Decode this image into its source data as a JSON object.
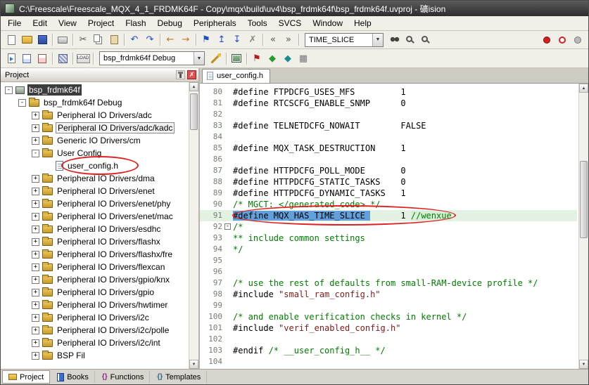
{
  "window": {
    "title": "C:\\Freescale\\Freescale_MQX_4_1_FRDMK64F - Copy\\mqx\\build\\uv4\\bsp_frdmk64f\\bsp_frdmk64f.uvproj - 礦ision"
  },
  "menubar": {
    "items": [
      "File",
      "Edit",
      "View",
      "Project",
      "Flash",
      "Debug",
      "Peripherals",
      "Tools",
      "SVCS",
      "Window",
      "Help"
    ]
  },
  "toolbar1": {
    "find_value": "TIME_SLICE",
    "before": [
      {
        "type": "icon",
        "name": "new-file-icon",
        "shape": "page"
      },
      {
        "type": "icon",
        "name": "open-file-icon",
        "shape": "folder-open"
      },
      {
        "type": "icon",
        "name": "save-icon",
        "shape": "floppy"
      },
      {
        "type": "sep"
      },
      {
        "type": "icon",
        "name": "print-icon",
        "shape": "printer"
      },
      {
        "type": "sep"
      },
      {
        "type": "icon",
        "name": "cut-icon",
        "glyph": "✂",
        "color": "#555555"
      },
      {
        "type": "icon",
        "name": "copy-icon",
        "shape": "copy"
      },
      {
        "type": "icon",
        "name": "paste-icon",
        "shape": "paste"
      },
      {
        "type": "sep"
      },
      {
        "type": "icon",
        "name": "undo-icon",
        "glyph": "↶",
        "color": "#2050c0"
      },
      {
        "type": "icon",
        "name": "redo-icon",
        "glyph": "↷",
        "color": "#2050c0"
      },
      {
        "type": "sep"
      },
      {
        "type": "icon",
        "name": "nav-back-icon",
        "glyph": "←",
        "color": "#c07820"
      },
      {
        "type": "icon",
        "name": "nav-forward-icon",
        "glyph": "→",
        "color": "#c07820"
      },
      {
        "type": "sep"
      },
      {
        "type": "icon",
        "name": "bookmark-toggle-icon",
        "glyph": "⚑",
        "color": "#2050c0"
      },
      {
        "type": "icon",
        "name": "bookmark-prev-icon",
        "glyph": "↥",
        "color": "#2050c0"
      },
      {
        "type": "icon",
        "name": "bookmark-next-icon",
        "glyph": "↧",
        "color": "#2050c0"
      },
      {
        "type": "icon",
        "name": "bookmark-clear-icon",
        "glyph": "✗",
        "color": "#888888"
      },
      {
        "type": "sep"
      },
      {
        "type": "icon",
        "name": "outdent-icon",
        "glyph": "«",
        "color": "#555555"
      },
      {
        "type": "icon",
        "name": "indent-icon",
        "glyph": "»",
        "color": "#555555"
      },
      {
        "type": "sep"
      }
    ],
    "after": [
      {
        "type": "icon",
        "name": "find-in-files-icon",
        "shape": "binoc"
      },
      {
        "type": "icon",
        "name": "find-icon",
        "shape": "mag"
      },
      {
        "type": "icon",
        "name": "incremental-find-icon",
        "shape": "mag"
      },
      {
        "type": "spacer"
      },
      {
        "type": "icon",
        "name": "insert-breakpoint-icon",
        "shape": "bp-red"
      },
      {
        "type": "icon",
        "name": "disable-breakpoint-icon",
        "shape": "bp-hollow"
      },
      {
        "type": "icon",
        "name": "kill-breakpoints-icon",
        "shape": "bp-gray"
      }
    ]
  },
  "toolbar2": {
    "target_value": "bsp_frdmk64f Debug",
    "before": [
      {
        "type": "icon",
        "name": "translate-icon",
        "shape": "page-arrow"
      },
      {
        "type": "icon",
        "name": "build-icon",
        "shape": "build"
      },
      {
        "type": "icon",
        "name": "rebuild-icon",
        "shape": "rebuild"
      },
      {
        "type": "sep"
      },
      {
        "type": "icon",
        "name": "batch-build-icon",
        "shape": "batch"
      },
      {
        "type": "sep"
      },
      {
        "type": "icon",
        "name": "flash-download-icon",
        "shape": "load",
        "text": "LOAD"
      },
      {
        "type": "sep"
      }
    ],
    "after": [
      {
        "type": "icon",
        "name": "options-for-target-icon",
        "shape": "wand"
      },
      {
        "type": "sep"
      },
      {
        "type": "icon",
        "name": "manage-items-icon",
        "shape": "items"
      },
      {
        "type": "sep"
      },
      {
        "type": "icon",
        "name": "flag-icon",
        "glyph": "⚑",
        "color": "#b02020"
      },
      {
        "type": "icon",
        "name": "next-diamond-icon",
        "glyph": "◆",
        "color": "#2a9a2a"
      },
      {
        "type": "icon",
        "name": "prev-diamond-icon",
        "glyph": "◆",
        "color": "#1a8a8a"
      },
      {
        "type": "icon",
        "name": "grid-icon",
        "glyph": "▦",
        "color": "#777777"
      }
    ]
  },
  "project_panel": {
    "title": "Project",
    "tree": [
      {
        "label": "bsp_frdmk64f",
        "indent": 0,
        "icon": "target",
        "expand": "-",
        "state": "selected"
      },
      {
        "label": "bsp_frdmk64f Debug",
        "indent": 1,
        "icon": "folder",
        "expand": "-"
      },
      {
        "label": "Peripheral IO Drivers/adc",
        "indent": 2,
        "icon": "folder",
        "expand": "+"
      },
      {
        "label": "Peripheral IO Drivers/adc/kadc",
        "indent": 2,
        "icon": "folder",
        "expand": "+",
        "state": "focused"
      },
      {
        "label": "Generic IO Drivers/cm",
        "indent": 2,
        "icon": "folder",
        "expand": "+"
      },
      {
        "label": "User Config",
        "indent": 2,
        "icon": "folder",
        "expand": "-"
      },
      {
        "label": "user_config.h",
        "indent": 3,
        "icon": "file",
        "expand": ""
      },
      {
        "label": "Peripheral IO Drivers/dma",
        "indent": 2,
        "icon": "folder",
        "expand": "+"
      },
      {
        "label": "Peripheral IO Drivers/enet",
        "indent": 2,
        "icon": "folder",
        "expand": "+"
      },
      {
        "label": "Peripheral IO Drivers/enet/phy",
        "indent": 2,
        "icon": "folder",
        "expand": "+"
      },
      {
        "label": "Peripheral IO Drivers/enet/mac",
        "indent": 2,
        "icon": "folder",
        "expand": "+"
      },
      {
        "label": "Peripheral IO Drivers/esdhc",
        "indent": 2,
        "icon": "folder",
        "expand": "+"
      },
      {
        "label": "Peripheral IO Drivers/flashx",
        "indent": 2,
        "icon": "folder",
        "expand": "+"
      },
      {
        "label": "Peripheral IO Drivers/flashx/fre",
        "indent": 2,
        "icon": "folder",
        "expand": "+"
      },
      {
        "label": "Peripheral IO Drivers/flexcan",
        "indent": 2,
        "icon": "folder",
        "expand": "+"
      },
      {
        "label": "Peripheral IO Drivers/gpio/knx",
        "indent": 2,
        "icon": "folder",
        "expand": "+"
      },
      {
        "label": "Peripheral IO Drivers/gpio",
        "indent": 2,
        "icon": "folder",
        "expand": "+"
      },
      {
        "label": "Peripheral IO Drivers/hwtimer",
        "indent": 2,
        "icon": "folder",
        "expand": "+"
      },
      {
        "label": "Peripheral IO Drivers/i2c",
        "indent": 2,
        "icon": "folder",
        "expand": "+"
      },
      {
        "label": "Peripheral IO Drivers/i2c/polle",
        "indent": 2,
        "icon": "folder",
        "expand": "+"
      },
      {
        "label": "Peripheral IO Drivers/i2c/int",
        "indent": 2,
        "icon": "folder",
        "expand": "+"
      },
      {
        "label": "BSP Fil",
        "indent": 2,
        "icon": "folder",
        "expand": "+"
      }
    ],
    "tabs": [
      {
        "label": "Project",
        "icon": "folder",
        "active": true
      },
      {
        "label": "Books",
        "icon": "book",
        "active": false
      },
      {
        "label": "Functions",
        "icon": "braces",
        "glyph": "{}",
        "active": false
      },
      {
        "label": "Templates",
        "icon": "braces2",
        "glyph": "{}",
        "active": false
      }
    ]
  },
  "editor": {
    "tab_label": "user_config.h",
    "lines": [
      {
        "n": 80,
        "seg": [
          [
            "ct",
            "#define FTPDCFG_USES_MFS         1"
          ]
        ]
      },
      {
        "n": 81,
        "seg": [
          [
            "ct",
            "#define RTCSCFG_ENABLE_SNMP      0"
          ]
        ]
      },
      {
        "n": 82,
        "seg": []
      },
      {
        "n": 83,
        "seg": [
          [
            "ct",
            "#define TELNETDCFG_NOWAIT        FALSE"
          ]
        ]
      },
      {
        "n": 84,
        "seg": []
      },
      {
        "n": 85,
        "seg": [
          [
            "ct",
            "#define MQX_TASK_DESTRUCTION     1"
          ]
        ]
      },
      {
        "n": 86,
        "seg": []
      },
      {
        "n": 87,
        "seg": [
          [
            "ct",
            "#define HTTPDCFG_POLL_MODE       0"
          ]
        ]
      },
      {
        "n": 88,
        "seg": [
          [
            "ct",
            "#define HTTPDCFG_STATIC_TASKS    0"
          ]
        ]
      },
      {
        "n": 89,
        "seg": [
          [
            "ct",
            "#define HTTPDCFG_DYNAMIC_TASKS   1"
          ]
        ]
      },
      {
        "n": 90,
        "seg": [
          [
            "cm",
            "/* MGCT: </generated_code> */"
          ]
        ]
      },
      {
        "n": 91,
        "hl": true,
        "seg": [
          [
            "sel",
            "#define MQX_HAS_TIME_SLICE "
          ],
          [
            "ct",
            "      1 "
          ],
          [
            "cmh",
            "//wenxue"
          ]
        ]
      },
      {
        "n": 92,
        "fold": "-",
        "seg": [
          [
            "cm",
            "/*"
          ]
        ]
      },
      {
        "n": 93,
        "seg": [
          [
            "cm",
            "** include common settings"
          ]
        ]
      },
      {
        "n": 94,
        "seg": [
          [
            "cm",
            "*/"
          ]
        ]
      },
      {
        "n": 95,
        "seg": []
      },
      {
        "n": 96,
        "seg": []
      },
      {
        "n": 97,
        "seg": [
          [
            "cm",
            "/* use the rest of defaults from small-RAM-device profile */"
          ]
        ]
      },
      {
        "n": 98,
        "seg": [
          [
            "ct",
            "#include "
          ],
          [
            "st",
            "\"small_ram_config.h\""
          ]
        ]
      },
      {
        "n": 99,
        "seg": []
      },
      {
        "n": 100,
        "seg": [
          [
            "cm",
            "/* and enable verification checks in kernel */"
          ]
        ]
      },
      {
        "n": 101,
        "seg": [
          [
            "ct",
            "#include "
          ],
          [
            "st",
            "\"verif_enabled_config.h\""
          ]
        ]
      },
      {
        "n": 102,
        "seg": []
      },
      {
        "n": 103,
        "seg": [
          [
            "ct",
            "#endif "
          ],
          [
            "cm",
            "/* __user_config_h__ */"
          ]
        ]
      },
      {
        "n": 104,
        "seg": []
      }
    ]
  },
  "colors": {
    "selection_bg": "#62a0dc",
    "comment": "#007d00",
    "string": "#7f1a1a",
    "line_highlight": "#e4f2e4",
    "annotation": "#e02020"
  }
}
